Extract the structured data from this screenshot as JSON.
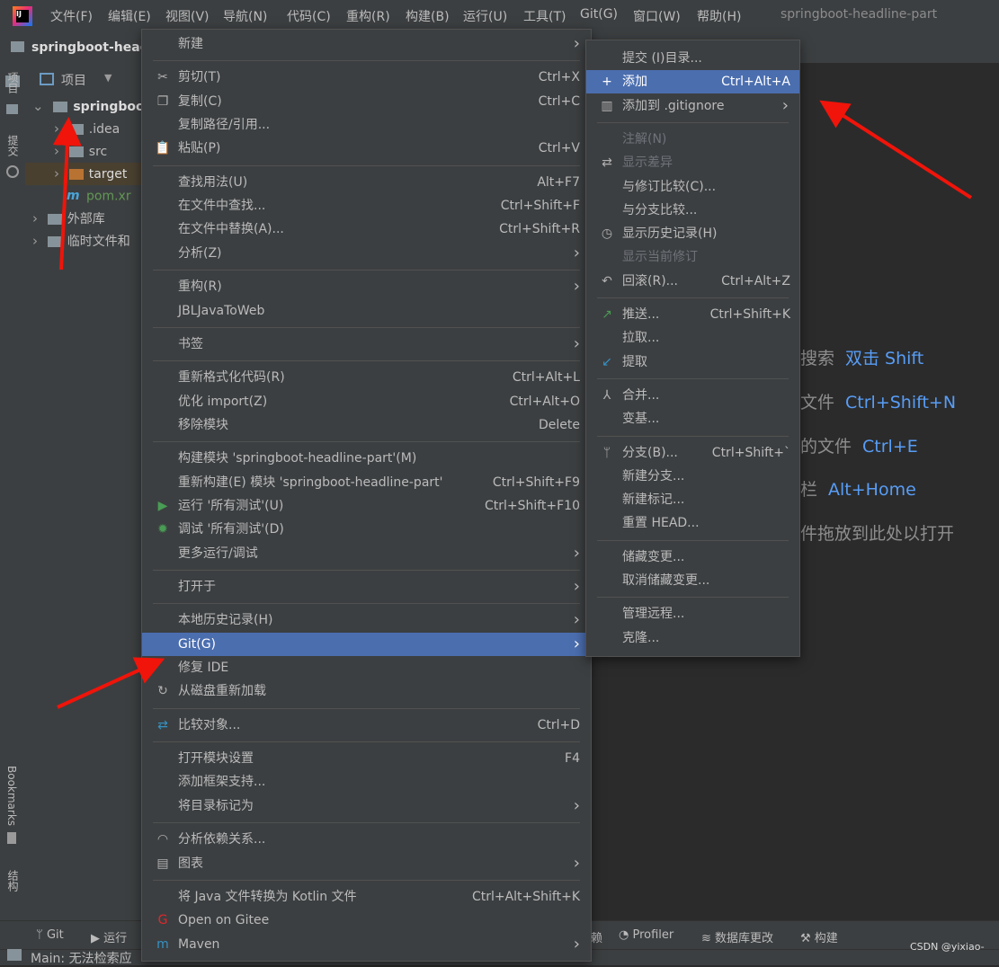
{
  "app": {
    "logo": "intellij-idea-logo",
    "menu": [
      "文件(F)",
      "编辑(E)",
      "视图(V)",
      "导航(N)",
      "代码(C)",
      "重构(R)",
      "构建(B)",
      "运行(U)",
      "工具(T)",
      "Git(G)",
      "窗口(W)",
      "帮助(H)"
    ],
    "window_title": "springboot-headline-part"
  },
  "navbar": {
    "project": "springboot-head"
  },
  "left_strip": {
    "project": "项目",
    "commit": "提交",
    "bookmarks": "Bookmarks",
    "structure": "结构"
  },
  "project_panel": {
    "header": "项目",
    "tree": [
      {
        "label": "springboo",
        "indent": 0,
        "open": true,
        "bold": true,
        "color": "#dcdcdc"
      },
      {
        "label": ".idea",
        "indent": 1,
        "open": false
      },
      {
        "label": "src",
        "indent": 1,
        "open": false
      },
      {
        "label": "target",
        "indent": 1,
        "open": false,
        "color": "#dcdcdc"
      },
      {
        "label": "pom.xr",
        "indent": 1,
        "color": "#629755"
      },
      {
        "label": "外部库",
        "indent": 0,
        "open": false
      },
      {
        "label": "临时文件和",
        "indent": 0,
        "open": false
      }
    ]
  },
  "editor_hints": [
    {
      "text": "搜索",
      "key": "双击 Shift"
    },
    {
      "text": "文件",
      "key": "Ctrl+Shift+N"
    },
    {
      "text": "的文件",
      "key": "Ctrl+E"
    },
    {
      "text": "栏",
      "key": "Alt+Home"
    },
    {
      "text": "件拖放到此处以打开",
      "key": ""
    }
  ],
  "context_menu": [
    {
      "label": "新建",
      "submenu": true
    },
    {
      "sep": true
    },
    {
      "label": "剪切(T)",
      "shortcut": "Ctrl+X",
      "icon": "scissors-icon"
    },
    {
      "label": "复制(C)",
      "shortcut": "Ctrl+C",
      "icon": "copy-icon"
    },
    {
      "label": "复制路径/引用..."
    },
    {
      "label": "粘贴(P)",
      "shortcut": "Ctrl+V",
      "icon": "paste-icon"
    },
    {
      "sep": true
    },
    {
      "label": "查找用法(U)",
      "shortcut": "Alt+F7"
    },
    {
      "label": "在文件中查找...",
      "shortcut": "Ctrl+Shift+F"
    },
    {
      "label": "在文件中替换(A)...",
      "shortcut": "Ctrl+Shift+R"
    },
    {
      "label": "分析(Z)",
      "submenu": true
    },
    {
      "sep": true
    },
    {
      "label": "重构(R)",
      "submenu": true
    },
    {
      "label": "JBLJavaToWeb"
    },
    {
      "sep": true
    },
    {
      "label": "书签",
      "submenu": true
    },
    {
      "sep": true
    },
    {
      "label": "重新格式化代码(R)",
      "shortcut": "Ctrl+Alt+L"
    },
    {
      "label": "优化 import(Z)",
      "shortcut": "Ctrl+Alt+O"
    },
    {
      "label": "移除模块",
      "shortcut": "Delete"
    },
    {
      "sep": true
    },
    {
      "label": "构建模块 'springboot-headline-part'(M)"
    },
    {
      "label": "重新构建(E) 模块 'springboot-headline-part'",
      "shortcut": "Ctrl+Shift+F9"
    },
    {
      "label": "运行 '所有测试'(U)",
      "shortcut": "Ctrl+Shift+F10",
      "icon": "run-icon"
    },
    {
      "label": "调试 '所有测试'(D)",
      "icon": "debug-icon"
    },
    {
      "label": "更多运行/调试",
      "submenu": true
    },
    {
      "sep": true
    },
    {
      "label": "打开于",
      "submenu": true
    },
    {
      "sep": true
    },
    {
      "label": "本地历史记录(H)",
      "submenu": true
    },
    {
      "label": "Git(G)",
      "submenu": true,
      "selected": true
    },
    {
      "label": "修复 IDE"
    },
    {
      "label": "从磁盘重新加载",
      "icon": "reload-icon"
    },
    {
      "sep": true
    },
    {
      "label": "比较对象...",
      "shortcut": "Ctrl+D",
      "icon": "compare-icon"
    },
    {
      "sep": true
    },
    {
      "label": "打开模块设置",
      "shortcut": "F4"
    },
    {
      "label": "添加框架支持..."
    },
    {
      "label": "将目录标记为",
      "submenu": true
    },
    {
      "sep": true
    },
    {
      "label": "分析依赖关系...",
      "icon": "dependency-icon"
    },
    {
      "label": "图表",
      "submenu": true,
      "icon": "diagram-icon"
    },
    {
      "sep": true
    },
    {
      "label": "将 Java 文件转换为 Kotlin 文件",
      "shortcut": "Ctrl+Alt+Shift+K"
    },
    {
      "label": "Open on Gitee",
      "icon": "gitee-icon"
    },
    {
      "label": "Maven",
      "submenu": true,
      "icon": "maven-icon"
    }
  ],
  "git_menu": [
    {
      "label": "提交 (I)目录..."
    },
    {
      "label": "添加",
      "shortcut": "Ctrl+Alt+A",
      "selected": true,
      "icon": "plus-icon"
    },
    {
      "label": "添加到 .gitignore",
      "submenu": true,
      "icon": "gitignore-icon"
    },
    {
      "sep": true
    },
    {
      "label": "注解(N)",
      "disabled": true
    },
    {
      "label": "显示差异",
      "disabled": true,
      "icon": "diff-icon"
    },
    {
      "label": "与修订比较(C)..."
    },
    {
      "label": "与分支比较..."
    },
    {
      "label": "显示历史记录(H)",
      "icon": "history-icon"
    },
    {
      "label": "显示当前修订",
      "disabled": true
    },
    {
      "label": "回滚(R)...",
      "shortcut": "Ctrl+Alt+Z",
      "icon": "rollback-icon"
    },
    {
      "sep": true
    },
    {
      "label": "推送...",
      "shortcut": "Ctrl+Shift+K",
      "icon": "push-icon"
    },
    {
      "label": "拉取..."
    },
    {
      "label": "提取",
      "icon": "fetch-icon"
    },
    {
      "sep": true
    },
    {
      "label": "合并...",
      "icon": "merge-icon"
    },
    {
      "label": "变基..."
    },
    {
      "sep": true
    },
    {
      "label": "分支(B)...",
      "shortcut": "Ctrl+Shift+`",
      "icon": "branch-icon"
    },
    {
      "label": "新建分支..."
    },
    {
      "label": "新建标记..."
    },
    {
      "label": "重置 HEAD..."
    },
    {
      "sep": true
    },
    {
      "label": "储藏变更..."
    },
    {
      "label": "取消储藏变更..."
    },
    {
      "sep": true
    },
    {
      "label": "管理远程..."
    },
    {
      "label": "克隆..."
    }
  ],
  "bottom_bar": {
    "git": "Git",
    "run": "运行",
    "find_partial": "赖",
    "profiler": "Profiler",
    "db_changes": "数据库更改",
    "build": "构建"
  },
  "status": {
    "text": "Main: 无法检索应",
    "watermark": "CSDN @yixiao-"
  },
  "colors": {
    "accent": "#4b6eaf",
    "menu_bg": "#3c3f41",
    "editor_bg": "#2b2b2b",
    "link": "#589df6",
    "arrow": "#f0140a"
  }
}
